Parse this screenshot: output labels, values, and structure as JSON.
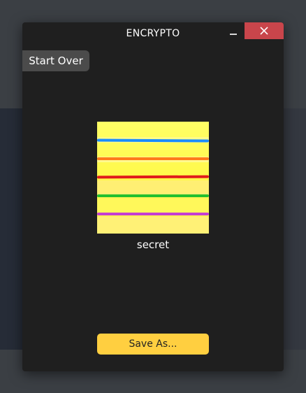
{
  "window": {
    "title": "ENCRYPTO",
    "minimize_icon": "minimize-icon",
    "close_icon": "close-icon"
  },
  "toolbar": {
    "start_over_label": "Start Over"
  },
  "file": {
    "name": "secret",
    "thumbnail_colors": {
      "background": "#fff94a",
      "stripes": [
        "#1a8cff",
        "#ff7a1a",
        "#e01b1b",
        "#22c02e",
        "#c43fd1"
      ]
    }
  },
  "actions": {
    "save_label": "Save As..."
  },
  "colors": {
    "window_bg": "#1f1f1f",
    "close_red": "#c9454b",
    "accent_yellow": "#ffcf40",
    "button_grey": "#4b4b4b"
  }
}
